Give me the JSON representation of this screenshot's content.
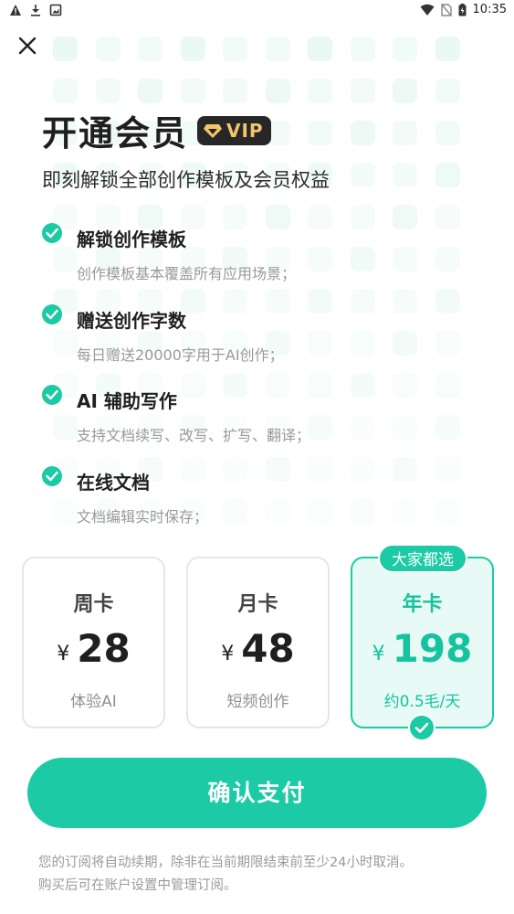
{
  "status_bar": {
    "time": "10:35",
    "left_icons": [
      "warning-icon",
      "download-icon",
      "image-icon"
    ],
    "right_icons": [
      "wifi-icon",
      "no-sim-icon",
      "battery-icon"
    ]
  },
  "close_icon": "close-icon",
  "header": {
    "title": "开通会员",
    "vip_label": "VIP",
    "subtitle": "即刻解锁全部创作模板及会员权益"
  },
  "benefits": [
    {
      "title": "解锁创作模板",
      "desc": "创作模板基本覆盖所有应用场景；"
    },
    {
      "title": "赠送创作字数",
      "desc": "每日赠送20000字用于AI创作；"
    },
    {
      "title": "AI 辅助写作",
      "desc": "支持文档续写、改写、扩写、翻译；"
    },
    {
      "title": "在线文档",
      "desc": "文档编辑实时保存；"
    }
  ],
  "plans": [
    {
      "name": "周卡",
      "currency": "¥",
      "price": "28",
      "note": "体验AI"
    },
    {
      "name": "月卡",
      "currency": "¥",
      "price": "48",
      "note": "短频创作"
    },
    {
      "name": "年卡",
      "currency": "¥",
      "price": "198",
      "note": "约0.5毛/天",
      "tag": "大家都选"
    }
  ],
  "selected_plan": "年卡",
  "confirm_button": "确认支付",
  "footnote": {
    "line1": "您的订阅将自动续期，除非在当前期限结束前至少24小时取消。",
    "line2": "购买后可在账户设置中管理订阅。"
  },
  "colors": {
    "accent": "#1ccaa5",
    "accent_light": "#e7faf5",
    "vip_badge_bg": "#272727",
    "vip_gold": "#f2c66a"
  }
}
